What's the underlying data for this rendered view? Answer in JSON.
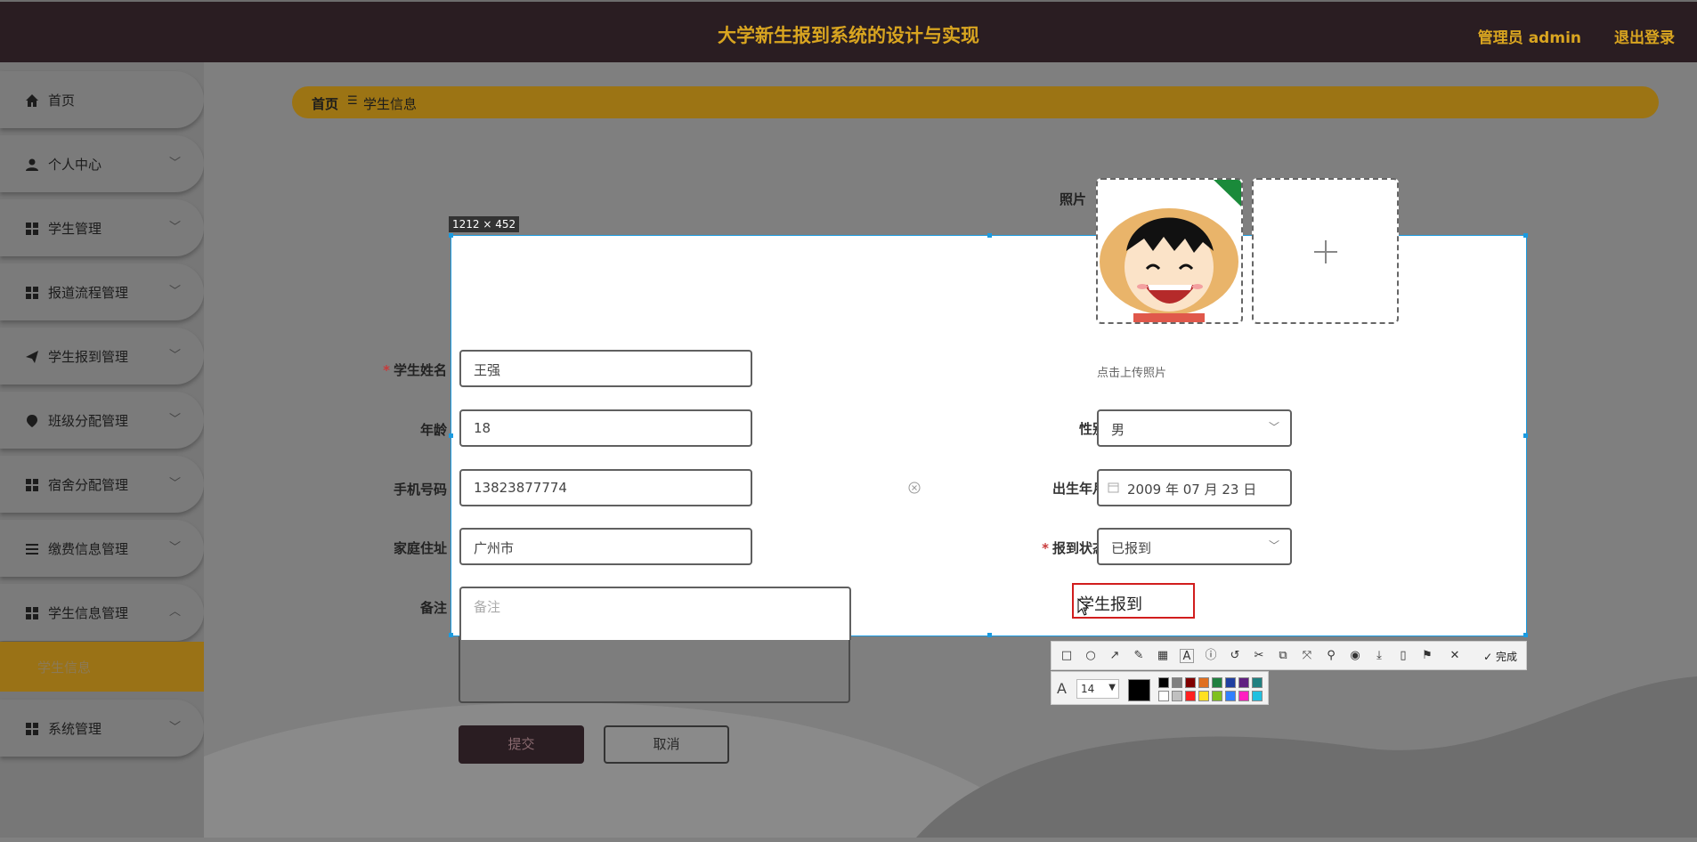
{
  "header": {
    "title": "大学新生报到系统的设计与实现",
    "admin": "管理员 admin",
    "logout": "退出登录"
  },
  "sidebar": {
    "items": [
      {
        "label": "首页",
        "icon": "home-icon"
      },
      {
        "label": "个人中心",
        "icon": "user-icon"
      },
      {
        "label": "学生管理",
        "icon": "grid-icon"
      },
      {
        "label": "报道流程管理",
        "icon": "grid-icon"
      },
      {
        "label": "学生报到管理",
        "icon": "send-icon"
      },
      {
        "label": "班级分配管理",
        "icon": "location-icon"
      },
      {
        "label": "宿舍分配管理",
        "icon": "grid-icon"
      },
      {
        "label": "缴费信息管理",
        "icon": "list-icon"
      },
      {
        "label": "学生信息管理",
        "icon": "grid-icon"
      },
      {
        "label": "系统管理",
        "icon": "grid-icon"
      }
    ],
    "sub_item": "学生信息"
  },
  "breadcrumb": {
    "home": "首页",
    "separator": "☰",
    "current": "学生信息"
  },
  "form": {
    "photo_label": "照片",
    "upload_tip": "点击上传照片",
    "name_label": "学生姓名",
    "name_value": "王强",
    "age_label": "年龄",
    "age_value": "18",
    "gender_label": "性别",
    "gender_value": "男",
    "phone_label": "手机号码",
    "phone_value": "13823877774",
    "birth_label": "出生年月",
    "birth_value": "2009 年 07 月 23 日",
    "address_label": "家庭住址",
    "address_value": "广州市",
    "status_label": "报到状态",
    "status_value": "已报到",
    "remark_label": "备注",
    "remark_placeholder": "备注",
    "submit": "提交",
    "cancel": "取消",
    "required_mark": "*"
  },
  "capture": {
    "size": "1212 × 452",
    "text_annotation": "学生报到",
    "font_size": "14",
    "done": "完成"
  },
  "colors": {
    "header_bg": "#2a1d22",
    "accent": "#d9a520",
    "selection": "#1b9be0",
    "annotation": "#d11d1d"
  }
}
